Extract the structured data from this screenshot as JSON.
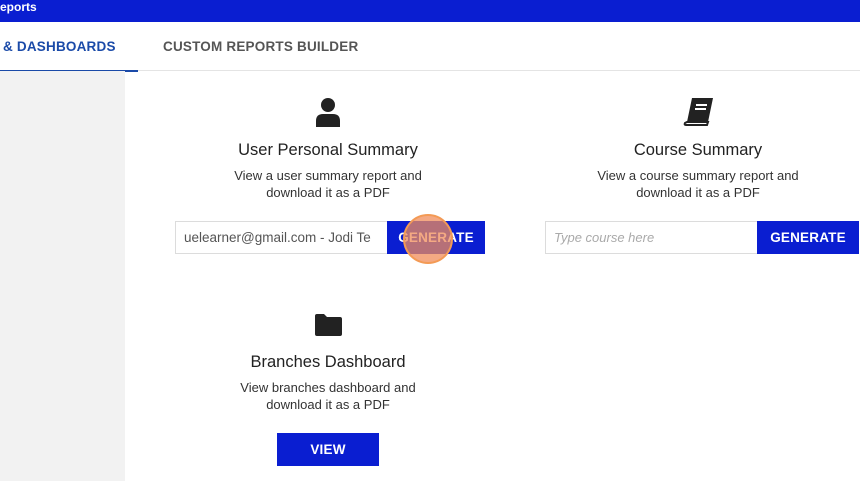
{
  "header": {
    "title": "eports"
  },
  "tabs": [
    {
      "label": "& DASHBOARDS",
      "active": true
    },
    {
      "label": "CUSTOM REPORTS BUILDER",
      "active": false
    }
  ],
  "cards": {
    "user_summary": {
      "icon": "user-icon",
      "title": "User Personal Summary",
      "description": "View a user summary report and download it as a PDF",
      "input_value": "uelearner@gmail.com - Jodi Te",
      "button_label": "GENERATE"
    },
    "course_summary": {
      "icon": "book-icon",
      "title": "Course Summary",
      "description": "View a course summary report and download it as a PDF",
      "input_placeholder": "Type course here",
      "button_label": "GENERATE"
    },
    "branches_dashboard": {
      "icon": "folder-icon",
      "title": "Branches Dashboard",
      "description": "View branches dashboard and download it as a PDF",
      "button_label": "VIEW"
    }
  },
  "colors": {
    "brand": "#0a1ed1",
    "tab_active": "#1a4aa8",
    "click_marker": "#f39a55"
  }
}
